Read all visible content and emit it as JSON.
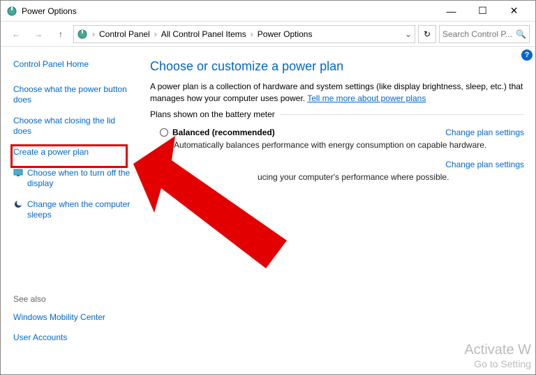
{
  "window": {
    "title": "Power Options",
    "minimize": "—",
    "maximize": "☐",
    "close": "✕"
  },
  "nav": {
    "back": "←",
    "forward": "→",
    "up": "↑"
  },
  "breadcrumb": {
    "items": [
      "Control Panel",
      "All Control Panel Items",
      "Power Options"
    ],
    "dropdown": "⌄",
    "refresh": "↻"
  },
  "search": {
    "placeholder": "Search Control P..."
  },
  "sidebar": {
    "home": "Control Panel Home",
    "links": [
      "Choose what the power button does",
      "Choose what closing the lid does",
      "Create a power plan",
      "Choose when to turn off the display",
      "Change when the computer sleeps"
    ]
  },
  "seealso": {
    "label": "See also",
    "links": [
      "Windows Mobility Center",
      "User Accounts"
    ]
  },
  "main": {
    "heading": "Choose or customize a power plan",
    "description": "A power plan is a collection of hardware and system settings (like display brightness, sleep, etc.) that manages how your computer uses power. ",
    "learn_more": "Tell me more about power plans",
    "plans_label": "Plans shown on the battery meter",
    "plans": [
      {
        "name": "Balanced (recommended)",
        "desc": "Automatically balances performance with energy consumption on capable hardware.",
        "change": "Change plan settings"
      },
      {
        "name": "",
        "desc": "ucing your computer's performance where possible.",
        "change": "Change plan settings"
      }
    ]
  },
  "help": "?",
  "watermark": {
    "big": "Activate W",
    "small": "Go to Setting"
  }
}
